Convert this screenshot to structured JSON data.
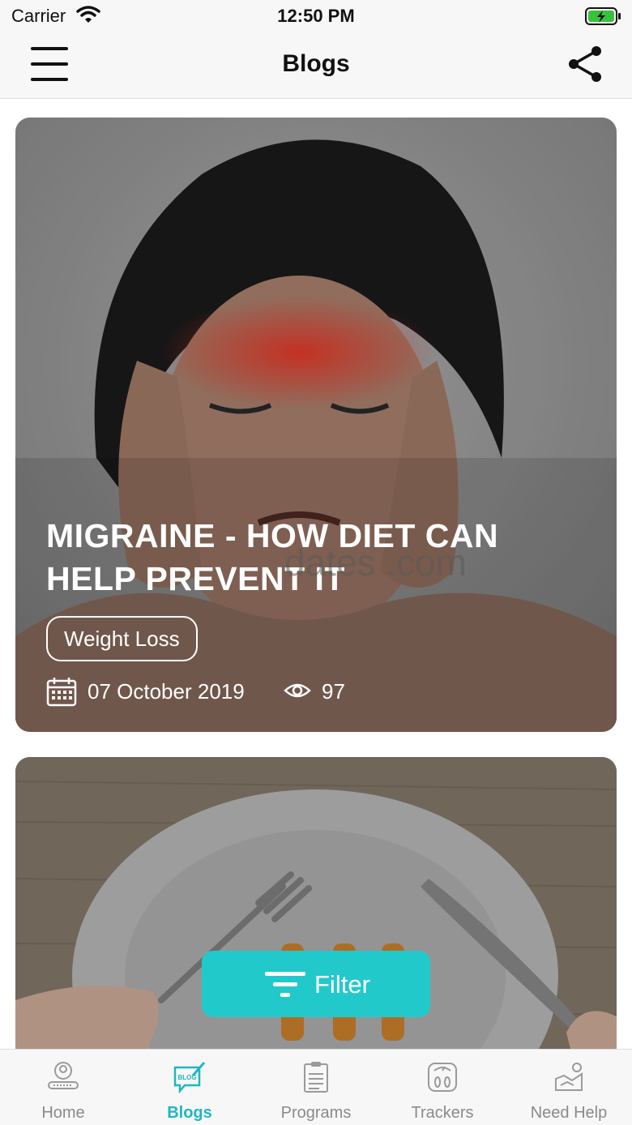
{
  "status_bar": {
    "carrier": "Carrier",
    "time": "12:50 PM"
  },
  "nav": {
    "title": "Blogs"
  },
  "cards": [
    {
      "title": "MIGRAINE - HOW DIET CAN HELP PREVENT IT",
      "watermark": "dates .com",
      "tag": "Weight Loss",
      "date": "07 October 2019",
      "views": "97"
    }
  ],
  "filter": {
    "label": "Filter"
  },
  "tabs": [
    {
      "label": "Home",
      "icon": "home-person-icon"
    },
    {
      "label": "Blogs",
      "icon": "blog-icon",
      "active": true
    },
    {
      "label": "Programs",
      "icon": "clipboard-icon"
    },
    {
      "label": "Trackers",
      "icon": "scale-icon"
    },
    {
      "label": "Need Help",
      "icon": "help-icon"
    }
  ],
  "colors": {
    "accent": "#22c9cb",
    "tab_active": "#1fb7c0",
    "bar_bg": "#f7f7f7",
    "battery": "#37c23c"
  }
}
